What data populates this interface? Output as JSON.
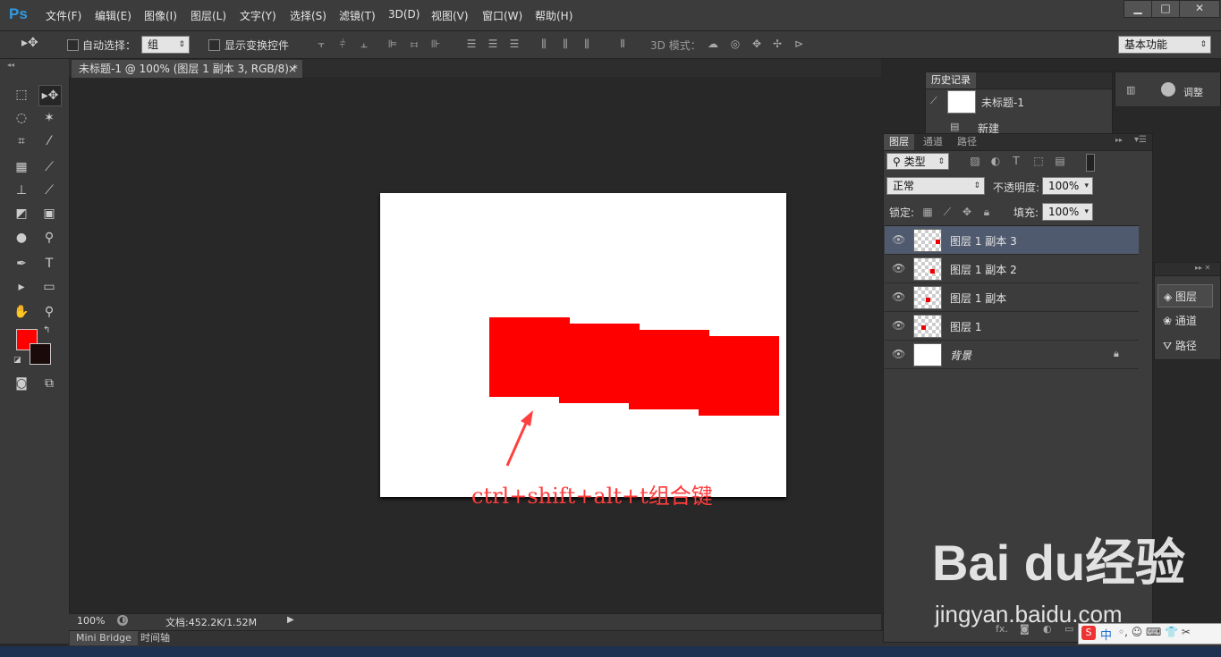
{
  "app": {
    "logo": "Ps"
  },
  "menu": [
    "文件(F)",
    "编辑(E)",
    "图像(I)",
    "图层(L)",
    "文字(Y)",
    "选择(S)",
    "滤镜(T)",
    "3D(D)",
    "视图(V)",
    "窗口(W)",
    "帮助(H)"
  ],
  "window_controls": {
    "minimize": "▁",
    "maximize": "□",
    "close": "✕"
  },
  "options": {
    "auto_select_label": "自动选择：",
    "auto_select_value": "组",
    "show_transform_label": "显示变换控件",
    "mode3d_label": "3D 模式：",
    "workspace": "基本功能"
  },
  "document_tab": {
    "title": "未标题-1 @ 100% (图层 1 副本 3, RGB/8) *",
    "close": "×"
  },
  "colors": {
    "foreground": "#ff0000",
    "background": "#1a0a0a",
    "shape": "#ff0000"
  },
  "canvas": {
    "annotation": "ctrl+shift+alt+t组合键"
  },
  "status": {
    "zoom": "100%",
    "doc_info": "文档:452.2K/1.52M"
  },
  "bottom_tabs": [
    "Mini Bridge",
    "时间轴"
  ],
  "history": {
    "tab": "历史记录",
    "items": [
      {
        "label": "未标题-1"
      },
      {
        "label": "新建"
      }
    ]
  },
  "adjust": {
    "label": "调整"
  },
  "layers_panel": {
    "tabs": [
      "图层",
      "通道",
      "路径"
    ],
    "filter_type": "类型",
    "blend_mode": "正常",
    "opacity_label": "不透明度:",
    "opacity_value": "100%",
    "lock_label": "锁定:",
    "fill_label": "填充:",
    "fill_value": "100%",
    "layers": [
      {
        "name": "图层 1 副本 3",
        "selected": true
      },
      {
        "name": "图层 1 副本 2",
        "selected": false
      },
      {
        "name": "图层 1 副本",
        "selected": false
      },
      {
        "name": "图层 1",
        "selected": false
      },
      {
        "name": "背景",
        "selected": false,
        "locked": true
      }
    ]
  },
  "side_panel": {
    "items": [
      {
        "label": "图层"
      },
      {
        "label": "通道"
      },
      {
        "label": "路径"
      }
    ]
  },
  "watermark": {
    "brand": "Bai du经验",
    "url": "jingyan.baidu.com"
  },
  "ime": {
    "label": "中"
  }
}
